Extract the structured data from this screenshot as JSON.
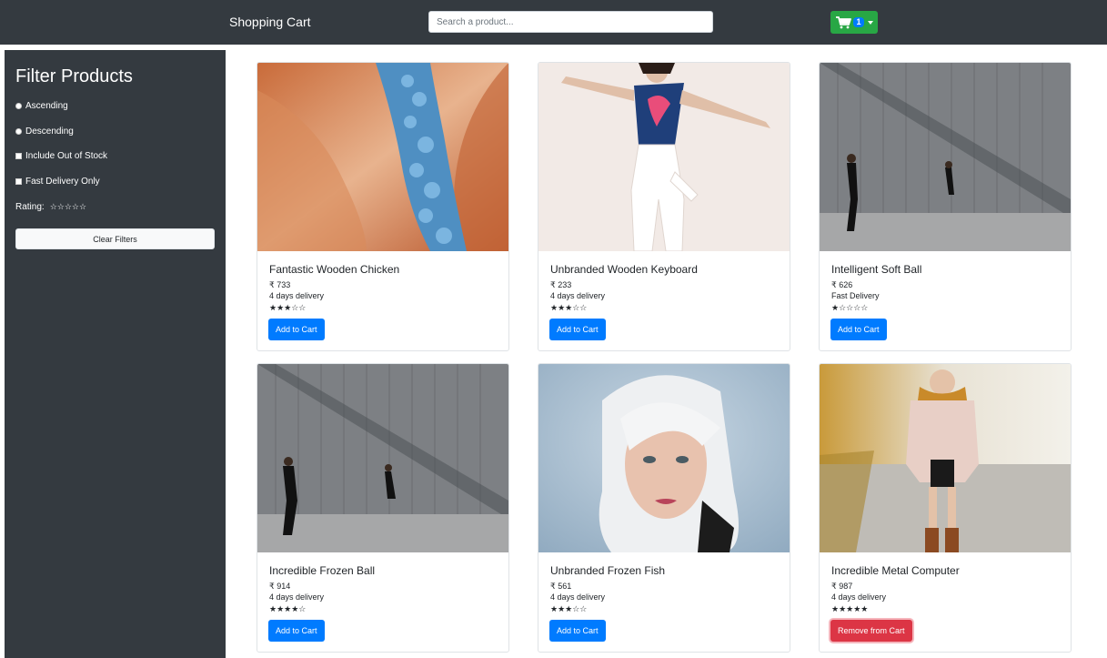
{
  "navbar": {
    "brand": "Shopping Cart",
    "search_placeholder": "Search a product...",
    "cart_count": "1",
    "cart_icon": "cart-icon"
  },
  "sidebar": {
    "title": "Filter Products",
    "ascending": "Ascending",
    "descending": "Descending",
    "out_of_stock": "Include Out of Stock",
    "fast_delivery": "Fast Delivery Only",
    "rating_label": "Rating:",
    "rating_stars": "☆☆☆☆☆",
    "clear_label": "Clear Filters"
  },
  "products": [
    {
      "name": "Fantastic Wooden Chicken",
      "price": "₹ 733",
      "delivery": "4 days delivery",
      "stars": "★★★☆☆",
      "button": "Add to Cart"
    },
    {
      "name": "Unbranded Wooden Keyboard",
      "price": "₹ 233",
      "delivery": "4 days delivery",
      "stars": "★★★☆☆",
      "button": "Add to Cart"
    },
    {
      "name": "Intelligent Soft Ball",
      "price": "₹ 626",
      "delivery": "Fast Delivery",
      "stars": "★☆☆☆☆",
      "button": "Add to Cart"
    },
    {
      "name": "Incredible Frozen Ball",
      "price": "₹ 914",
      "delivery": "4 days delivery",
      "stars": "★★★★☆",
      "button": "Add to Cart"
    },
    {
      "name": "Unbranded Frozen Fish",
      "price": "₹ 561",
      "delivery": "4 days delivery",
      "stars": "★★★☆☆",
      "button": "Add to Cart"
    },
    {
      "name": "Incredible Metal Computer",
      "price": "₹ 987",
      "delivery": "4 days delivery",
      "stars": "★★★★★",
      "button": "Remove from Cart"
    }
  ],
  "colors": {
    "navbar": "#343a40",
    "cart_button": "#28a745",
    "primary": "#007bff",
    "danger": "#dc3545"
  }
}
